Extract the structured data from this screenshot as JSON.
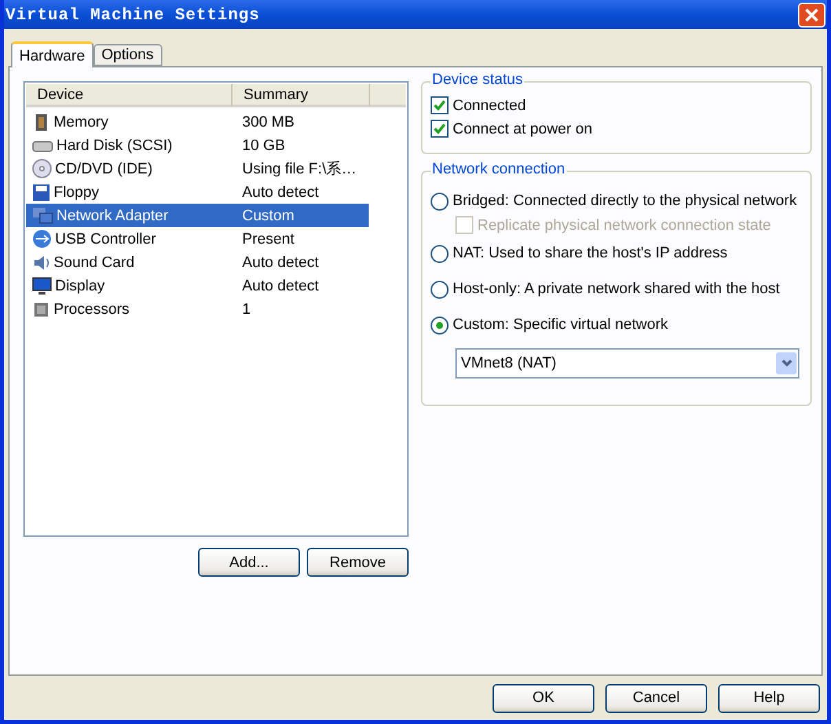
{
  "window": {
    "title": "Virtual Machine Settings"
  },
  "tabs": [
    {
      "label": "Hardware",
      "selected": true
    },
    {
      "label": "Options",
      "selected": false
    }
  ],
  "device_list": {
    "columns": [
      "Device",
      "Summary"
    ],
    "rows": [
      {
        "kind": "memory",
        "device": "Memory",
        "summary": "300 MB",
        "selected": false
      },
      {
        "kind": "disk",
        "device": "Hard Disk (SCSI)",
        "summary": "10 GB",
        "selected": false
      },
      {
        "kind": "cdrom",
        "device": "CD/DVD (IDE)",
        "summary": "Using file F:\\系…",
        "selected": false
      },
      {
        "kind": "floppy",
        "device": "Floppy",
        "summary": "Auto detect",
        "selected": false
      },
      {
        "kind": "network",
        "device": "Network Adapter",
        "summary": "Custom",
        "selected": true
      },
      {
        "kind": "usb",
        "device": "USB Controller",
        "summary": "Present",
        "selected": false
      },
      {
        "kind": "sound",
        "device": "Sound Card",
        "summary": "Auto detect",
        "selected": false
      },
      {
        "kind": "display",
        "device": "Display",
        "summary": "Auto detect",
        "selected": false
      },
      {
        "kind": "cpu",
        "device": "Processors",
        "summary": "1",
        "selected": false
      }
    ]
  },
  "list_buttons": [
    "Add...",
    "Remove"
  ],
  "device_status": {
    "title": "Device status",
    "options": [
      {
        "label": "Connected",
        "checked": true
      },
      {
        "label": "Connect at power on",
        "checked": true
      }
    ]
  },
  "network_connection": {
    "title": "Network connection",
    "options": [
      {
        "label": "Bridged: Connected directly to the physical network",
        "selected": false
      },
      {
        "label": "NAT: Used to share the host's IP address",
        "selected": false
      },
      {
        "label": "Host-only: A private network shared with the host",
        "selected": false
      },
      {
        "label": "Custom: Specific virtual network",
        "selected": true
      }
    ],
    "replicate": {
      "label": "Replicate physical network connection state",
      "checked": false,
      "disabled": true
    },
    "network": "VMnet8 (NAT)"
  },
  "buttons": [
    "OK",
    "Cancel",
    "Help"
  ]
}
